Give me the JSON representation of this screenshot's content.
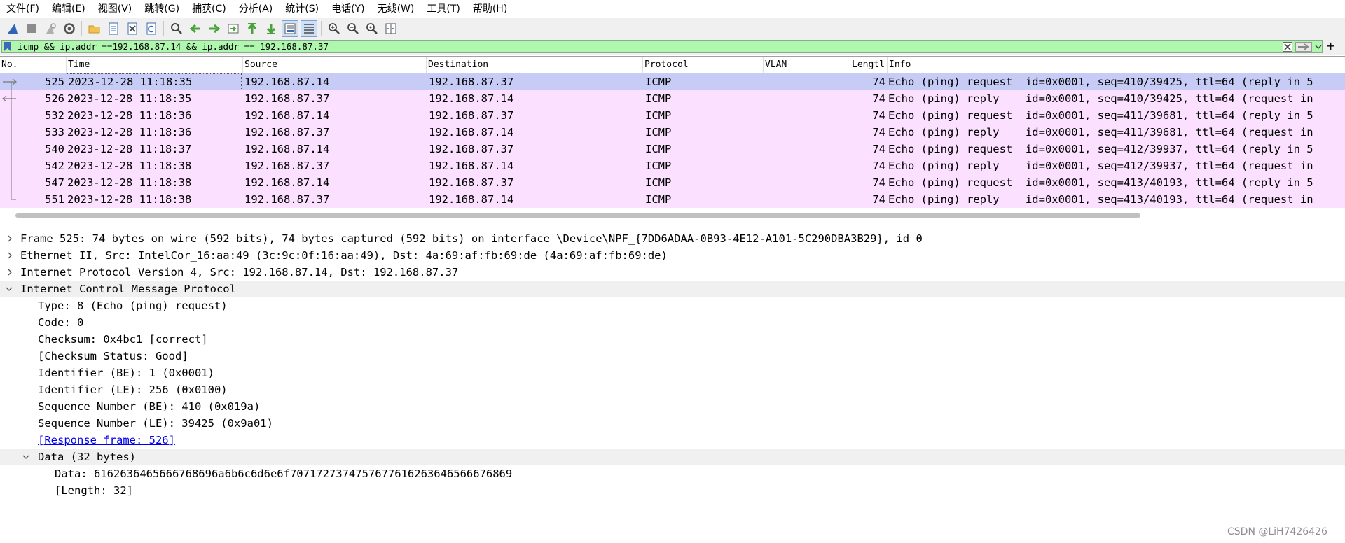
{
  "menu": [
    "文件(F)",
    "编辑(E)",
    "视图(V)",
    "跳转(G)",
    "捕获(C)",
    "分析(A)",
    "统计(S)",
    "电话(Y)",
    "无线(W)",
    "工具(T)",
    "帮助(H)"
  ],
  "toolbar_icons": [
    "shark-fin-start-icon",
    "stop-icon",
    "restart-icon",
    "capture-options-icon",
    "open-folder-icon",
    "save-file-icon",
    "close-file-icon",
    "reload-icon",
    "find-icon",
    "go-back-icon",
    "go-forward-icon",
    "go-to-packet-icon",
    "first-packet-icon",
    "last-packet-icon",
    "autoscroll-icon",
    "colorize-icon",
    "zoom-in-icon",
    "zoom-out-icon",
    "zoom-reset-icon",
    "resize-columns-icon"
  ],
  "filter": {
    "value": "icmp && ip.addr ==192.168.87.14 && ip.addr == 192.168.87.37",
    "add_label": "+"
  },
  "columns": [
    "No.",
    "Time",
    "Source",
    "Destination",
    "Protocol",
    "VLAN",
    "Lengtl",
    "Info"
  ],
  "packets": [
    {
      "no": "525",
      "time": "2023-12-28 11:18:35",
      "src": "192.168.87.14",
      "dst": "192.168.87.37",
      "proto": "ICMP",
      "len": "74",
      "info": "Echo (ping) request  id=0x0001, seq=410/39425, ttl=64 (reply in 5"
    },
    {
      "no": "526",
      "time": "2023-12-28 11:18:35",
      "src": "192.168.87.37",
      "dst": "192.168.87.14",
      "proto": "ICMP",
      "len": "74",
      "info": "Echo (ping) reply    id=0x0001, seq=410/39425, ttl=64 (request in"
    },
    {
      "no": "532",
      "time": "2023-12-28 11:18:36",
      "src": "192.168.87.14",
      "dst": "192.168.87.37",
      "proto": "ICMP",
      "len": "74",
      "info": "Echo (ping) request  id=0x0001, seq=411/39681, ttl=64 (reply in 5"
    },
    {
      "no": "533",
      "time": "2023-12-28 11:18:36",
      "src": "192.168.87.37",
      "dst": "192.168.87.14",
      "proto": "ICMP",
      "len": "74",
      "info": "Echo (ping) reply    id=0x0001, seq=411/39681, ttl=64 (request in"
    },
    {
      "no": "540",
      "time": "2023-12-28 11:18:37",
      "src": "192.168.87.14",
      "dst": "192.168.87.37",
      "proto": "ICMP",
      "len": "74",
      "info": "Echo (ping) request  id=0x0001, seq=412/39937, ttl=64 (reply in 5"
    },
    {
      "no": "542",
      "time": "2023-12-28 11:18:38",
      "src": "192.168.87.37",
      "dst": "192.168.87.14",
      "proto": "ICMP",
      "len": "74",
      "info": "Echo (ping) reply    id=0x0001, seq=412/39937, ttl=64 (request in"
    },
    {
      "no": "547",
      "time": "2023-12-28 11:18:38",
      "src": "192.168.87.14",
      "dst": "192.168.87.37",
      "proto": "ICMP",
      "len": "74",
      "info": "Echo (ping) request  id=0x0001, seq=413/40193, ttl=64 (reply in 5"
    },
    {
      "no": "551",
      "time": "2023-12-28 11:18:38",
      "src": "192.168.87.37",
      "dst": "192.168.87.14",
      "proto": "ICMP",
      "len": "74",
      "info": "Echo (ping) reply    id=0x0001, seq=413/40193, ttl=64 (request in"
    }
  ],
  "details": [
    {
      "text": "Frame 525: 74 bytes on wire (592 bits), 74 bytes captured (592 bits) on interface \\Device\\NPF_{7DD6ADAA-0B93-4E12-A101-5C290DBA3B29}, id 0",
      "arrow": "right",
      "level": 0
    },
    {
      "text": "Ethernet II, Src: IntelCor_16:aa:49 (3c:9c:0f:16:aa:49), Dst: 4a:69:af:fb:69:de (4a:69:af:fb:69:de)",
      "arrow": "right",
      "level": 0
    },
    {
      "text": "Internet Protocol Version 4, Src: 192.168.87.14, Dst: 192.168.87.37",
      "arrow": "right",
      "level": 0
    },
    {
      "text": "Internet Control Message Protocol",
      "arrow": "down",
      "level": 0,
      "highlight": true
    },
    {
      "text": "Type: 8 (Echo (ping) request)",
      "arrow": "",
      "level": 1
    },
    {
      "text": "Code: 0",
      "arrow": "",
      "level": 1
    },
    {
      "text": "Checksum: 0x4bc1 [correct]",
      "arrow": "",
      "level": 1
    },
    {
      "text": "[Checksum Status: Good]",
      "arrow": "",
      "level": 1
    },
    {
      "text": "Identifier (BE): 1 (0x0001)",
      "arrow": "",
      "level": 1
    },
    {
      "text": "Identifier (LE): 256 (0x0100)",
      "arrow": "",
      "level": 1
    },
    {
      "text": "Sequence Number (BE): 410 (0x019a)",
      "arrow": "",
      "level": 1
    },
    {
      "text": "Sequence Number (LE): 39425 (0x9a01)",
      "arrow": "",
      "level": 1
    },
    {
      "text": "[Response frame: 526]",
      "arrow": "",
      "level": 1,
      "link": true
    },
    {
      "text": "Data (32 bytes)",
      "arrow": "down",
      "level": 1,
      "highlight": true
    },
    {
      "text": "Data: 6162636465666768696a6b6c6d6e6f7071727374757677616263646566676869",
      "arrow": "",
      "level": 2
    },
    {
      "text": "[Length: 32]",
      "arrow": "",
      "level": 2
    }
  ],
  "watermark": "CSDN @LiH7426426",
  "colors": {
    "row_bg": "#fce0ff",
    "row_selected": "#c6ccf6",
    "filter_bg": "#aff7af"
  }
}
